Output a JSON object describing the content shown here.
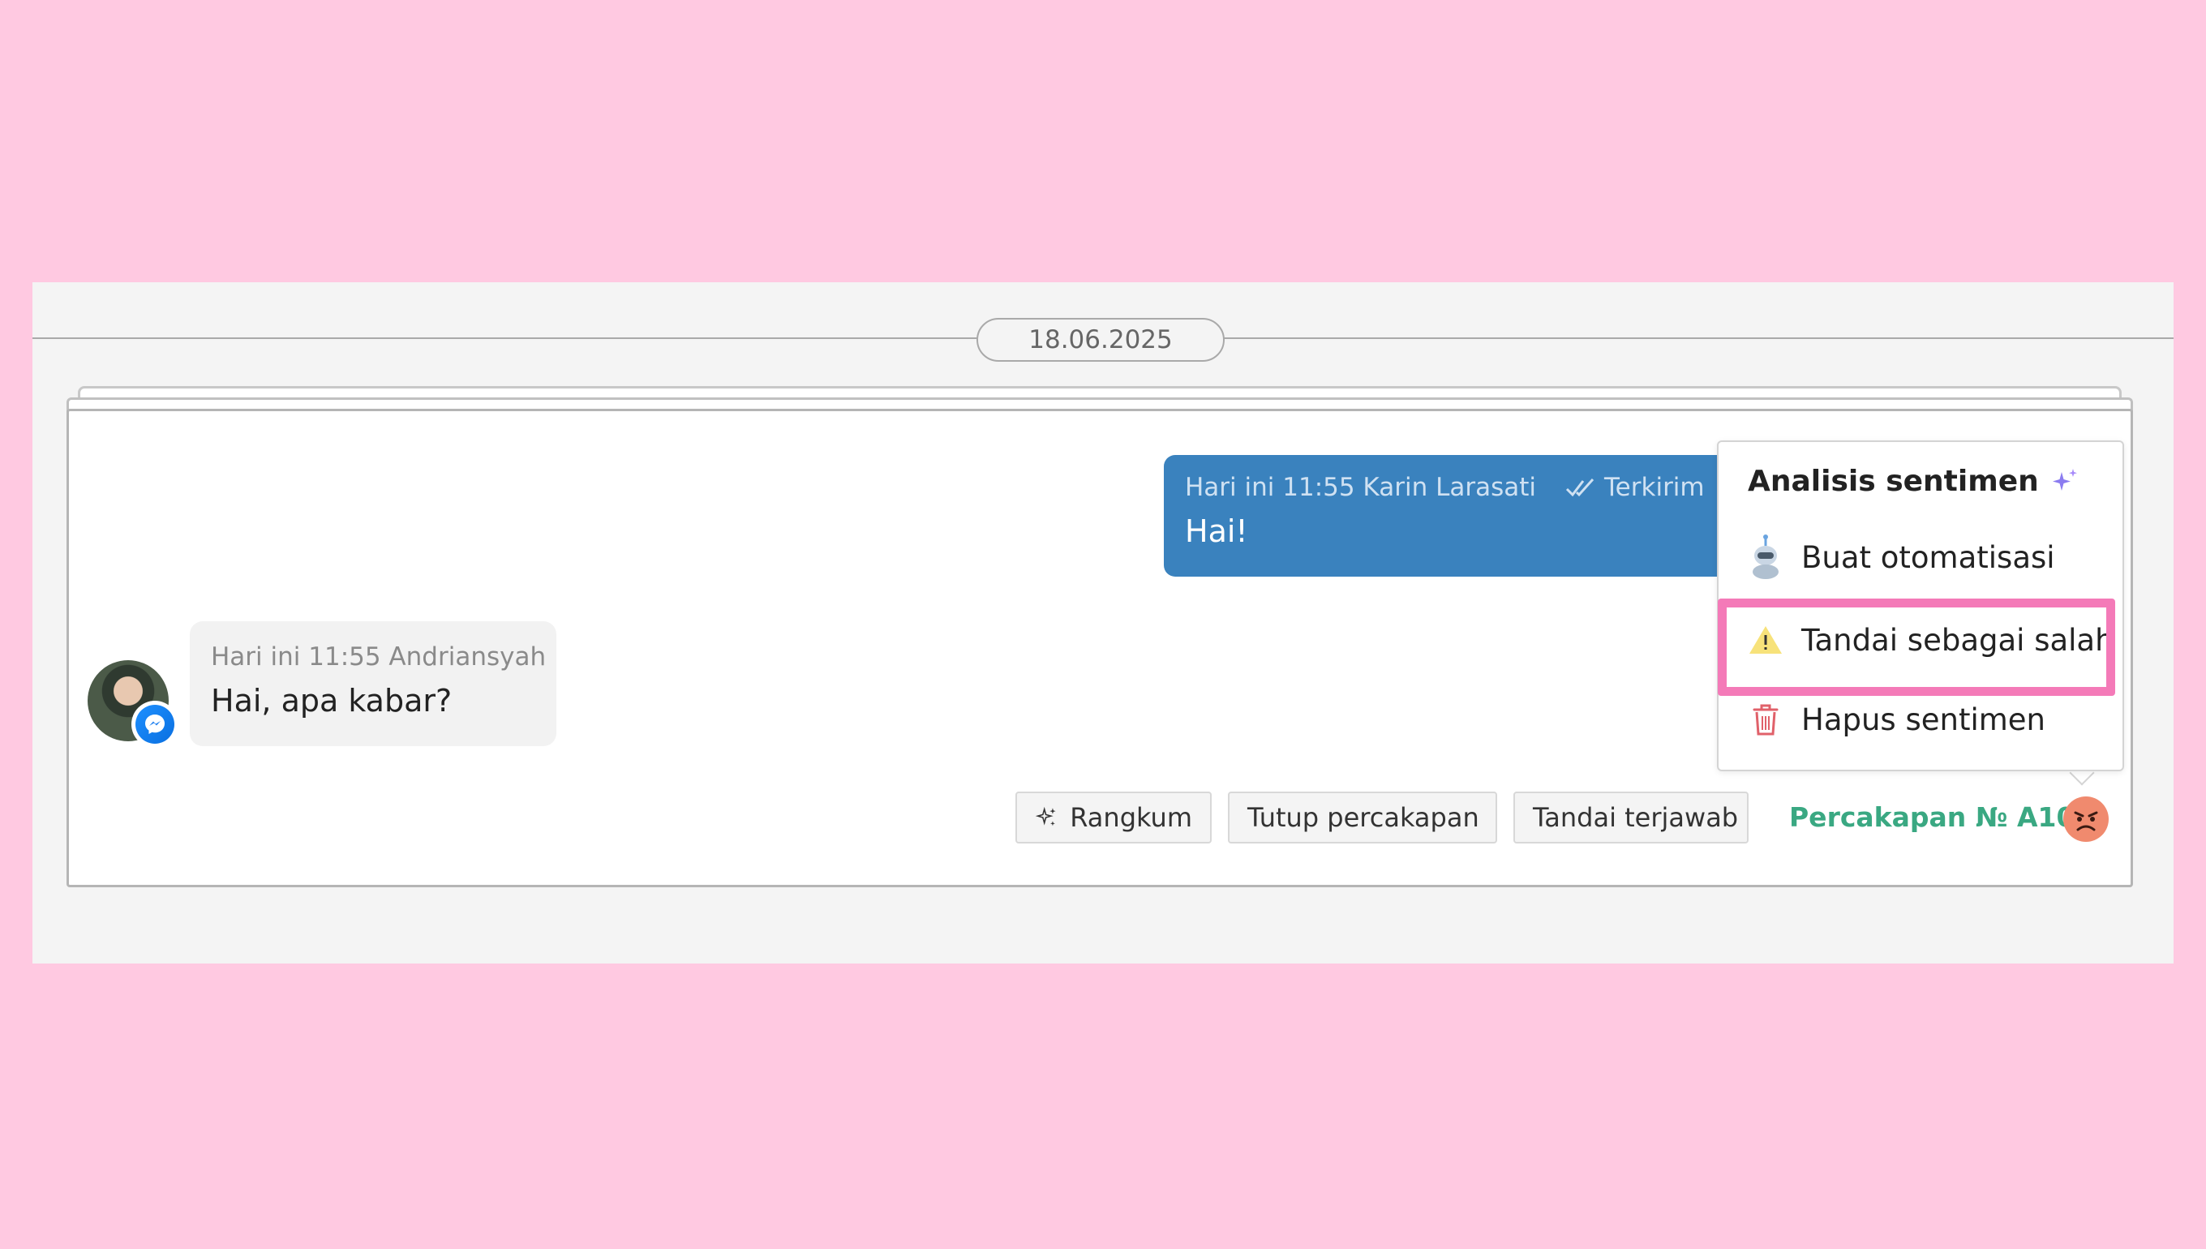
{
  "date_divider": "18.06.2025",
  "outgoing_message": {
    "meta": "Hari ini 11:55 Karin Larasati",
    "status": "Terkirim",
    "text": "Hai!"
  },
  "incoming_message": {
    "meta": "Hari ini 11:55 Andriansyah",
    "text": "Hai, apa kabar?",
    "channel_icon": "messenger-icon"
  },
  "actions": {
    "summarize": "Rangkum",
    "close_conversation": "Tutup percakapan",
    "mark_answered": "Tandai terjawab"
  },
  "conversation_id": "Percakapan № A100",
  "sentiment_menu": {
    "title": "Analisis sentimen",
    "items": [
      {
        "label": "Buat otomatisasi",
        "icon": "robot-icon"
      },
      {
        "label": "Tandai sebagai salah",
        "icon": "warning-icon"
      },
      {
        "label": "Hapus sentimen",
        "icon": "trash-icon"
      }
    ]
  },
  "colors": {
    "background": "#ffc9e1",
    "outgoing_bubble": "#3a82be",
    "conversation_id": "#3aa882",
    "highlight": "#f47ab8",
    "sentiment_negative": "#f08a6e"
  }
}
